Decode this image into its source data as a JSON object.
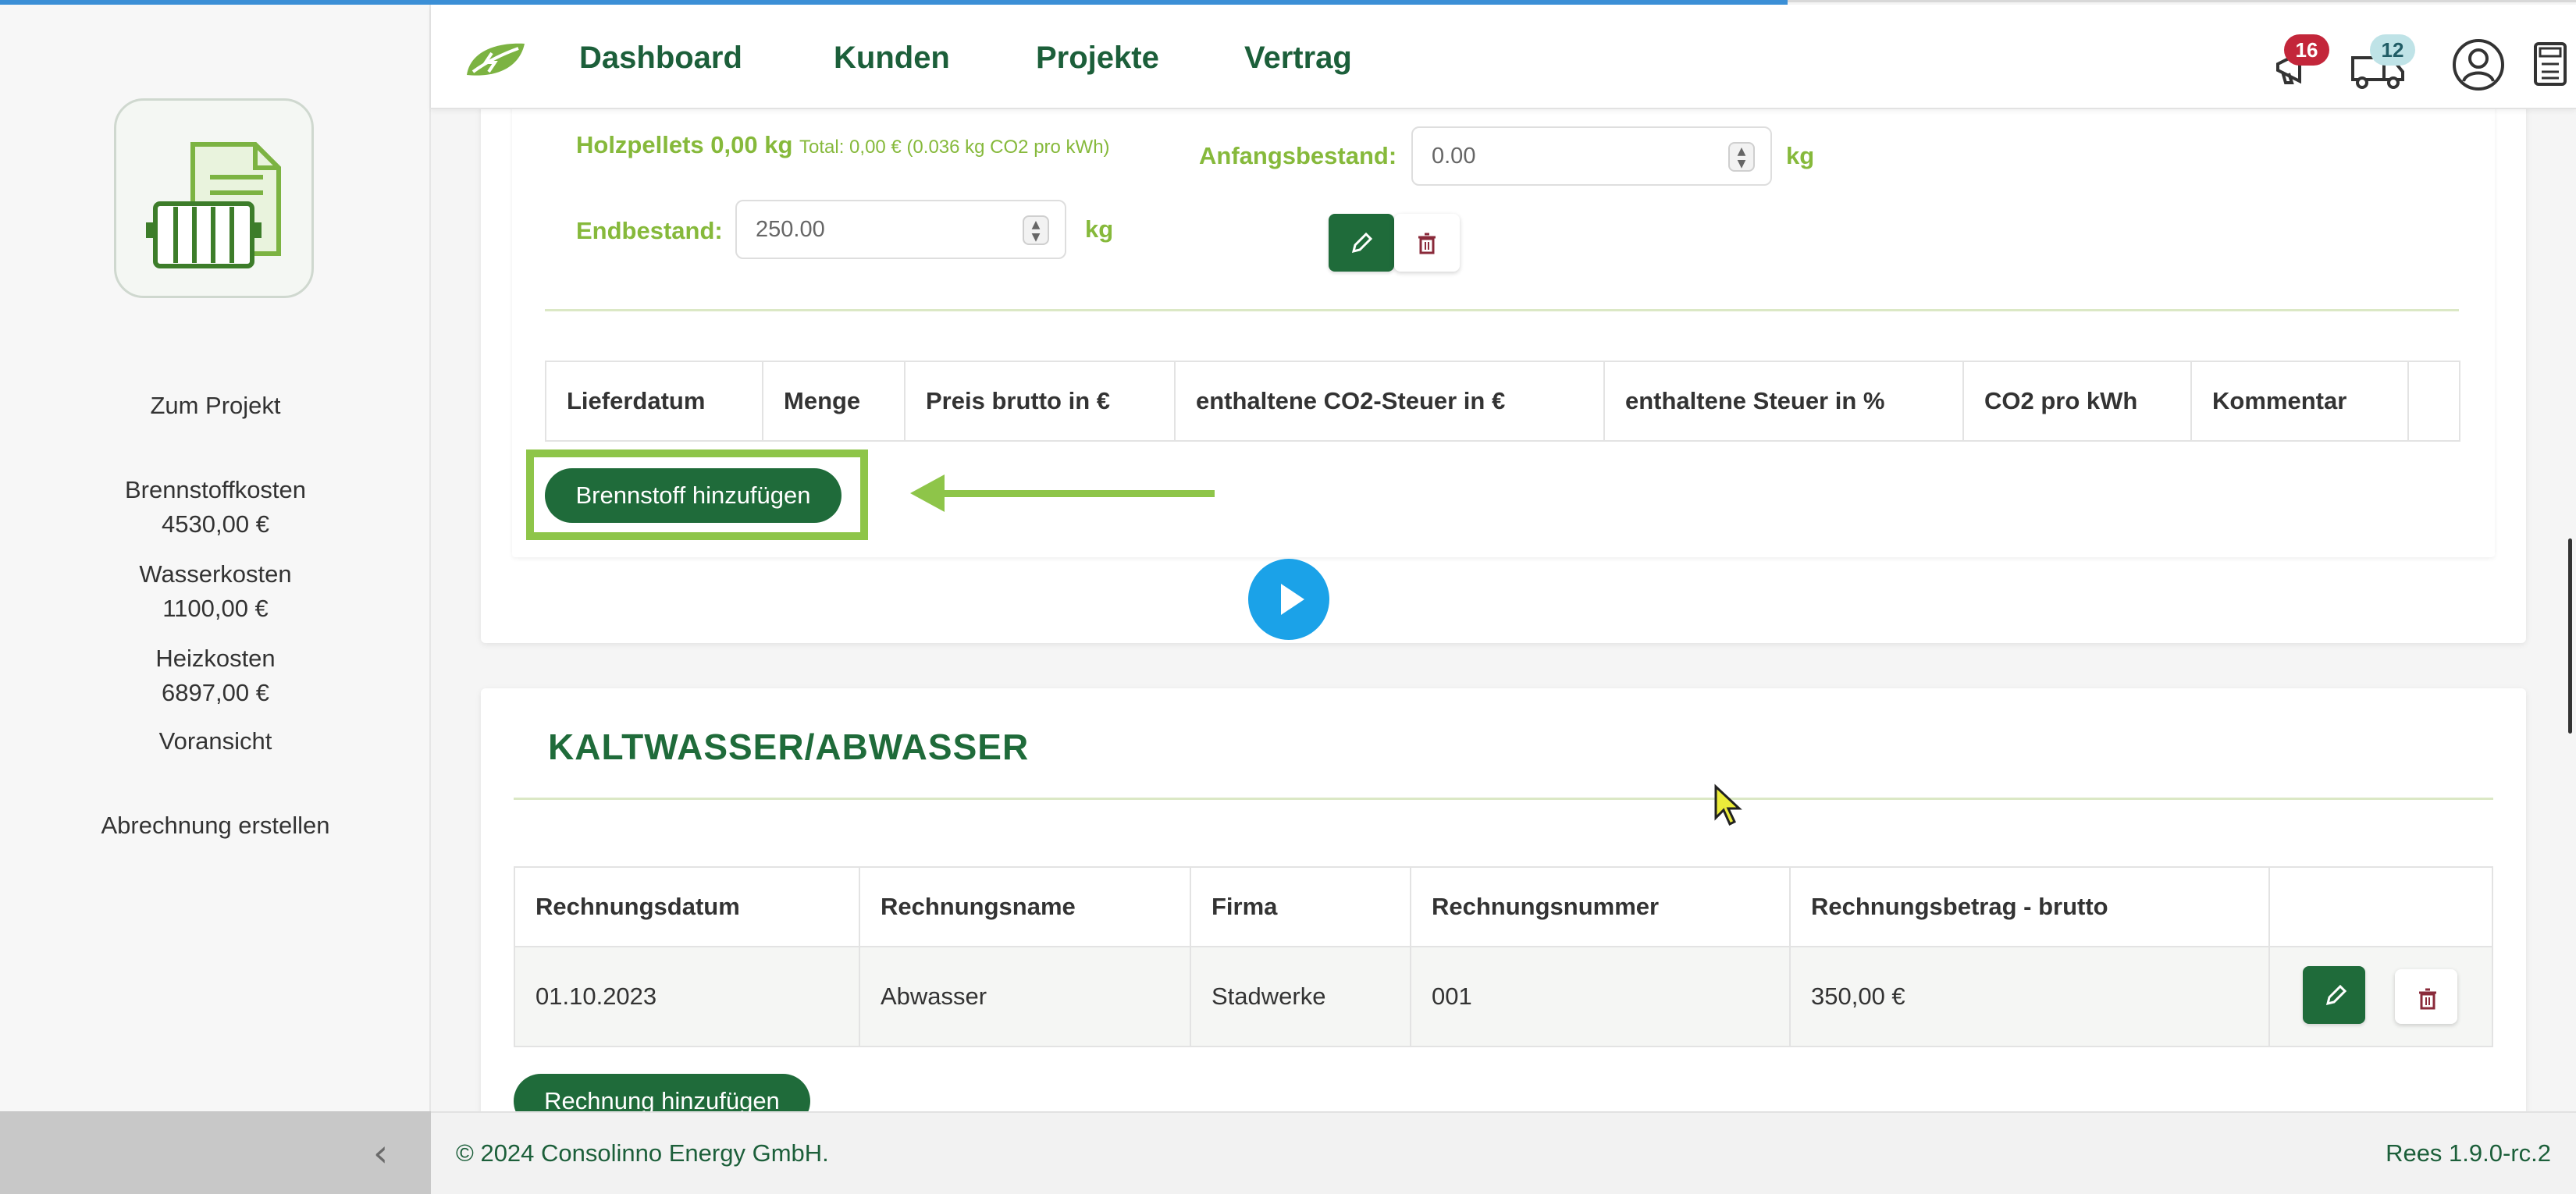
{
  "nav": {
    "items": [
      {
        "label": "Dashboard"
      },
      {
        "label": "Kunden"
      },
      {
        "label": "Projekte"
      },
      {
        "label": "Vertrag"
      }
    ],
    "notifications_count": "16",
    "deliveries_count": "12",
    "icons": [
      "megaphone-icon",
      "truck-icon",
      "user-icon",
      "calculator-icon"
    ]
  },
  "sidebar": {
    "project_link": "Zum Projekt",
    "fuel_costs_label": "Brennstoffkosten",
    "fuel_costs_value": "4530,00 €",
    "water_costs_label": "Wasserkosten",
    "water_costs_value": "1100,00 €",
    "heating_costs_label": "Heizkosten",
    "heating_costs_value": "6897,00 €",
    "preview": "Voransicht",
    "create_billing": "Abrechnung erstellen"
  },
  "fuel": {
    "name": "Holzpellets 0,00 kg",
    "total": "Total: 0,00 € (0.036 kg CO2 pro kWh)",
    "start_label": "Anfangsbestand:",
    "start_value": "0.00",
    "end_label": "Endbestand:",
    "end_value": "250.00",
    "unit": "kg",
    "table_headers": [
      "Lieferdatum",
      "Menge",
      "Preis brutto in €",
      "enthaltene CO2-Steuer in €",
      "enthaltene Steuer in %",
      "CO2 pro kWh",
      "Kommentar"
    ],
    "add_button": "Brennstoff hinzufügen"
  },
  "water": {
    "title": "KALTWASSER/ABWASSER",
    "table_headers": [
      "Rechnungsdatum",
      "Rechnungsname",
      "Firma",
      "Rechnungsnummer",
      "Rechnungsbetrag - brutto"
    ],
    "rows": [
      {
        "date": "01.10.2023",
        "name": "Abwasser",
        "company": "Stadwerke",
        "number": "001",
        "amount": "350,00 €"
      }
    ],
    "add_button": "Rechnung hinzufügen"
  },
  "footer": {
    "copyright": "© 2024 Consolinno Energy GmbH.",
    "version": "Rees 1.9.0-rc.2"
  },
  "colors": {
    "primary": "#1f6b3a",
    "accent": "#86b93b",
    "highlight": "#8ec549",
    "play": "#1ba2e8"
  }
}
